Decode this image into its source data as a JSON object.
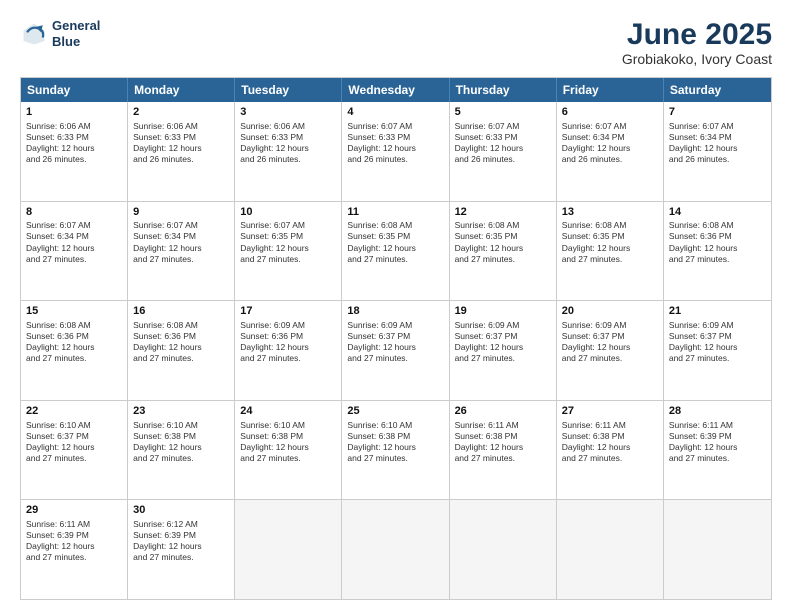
{
  "header": {
    "logo_line1": "General",
    "logo_line2": "Blue",
    "title": "June 2025",
    "subtitle": "Grobiakoko, Ivory Coast"
  },
  "weekdays": [
    "Sunday",
    "Monday",
    "Tuesday",
    "Wednesday",
    "Thursday",
    "Friday",
    "Saturday"
  ],
  "rows": [
    [
      {
        "day": "1",
        "lines": [
          "Sunrise: 6:06 AM",
          "Sunset: 6:33 PM",
          "Daylight: 12 hours",
          "and 26 minutes."
        ]
      },
      {
        "day": "2",
        "lines": [
          "Sunrise: 6:06 AM",
          "Sunset: 6:33 PM",
          "Daylight: 12 hours",
          "and 26 minutes."
        ]
      },
      {
        "day": "3",
        "lines": [
          "Sunrise: 6:06 AM",
          "Sunset: 6:33 PM",
          "Daylight: 12 hours",
          "and 26 minutes."
        ]
      },
      {
        "day": "4",
        "lines": [
          "Sunrise: 6:07 AM",
          "Sunset: 6:33 PM",
          "Daylight: 12 hours",
          "and 26 minutes."
        ]
      },
      {
        "day": "5",
        "lines": [
          "Sunrise: 6:07 AM",
          "Sunset: 6:33 PM",
          "Daylight: 12 hours",
          "and 26 minutes."
        ]
      },
      {
        "day": "6",
        "lines": [
          "Sunrise: 6:07 AM",
          "Sunset: 6:34 PM",
          "Daylight: 12 hours",
          "and 26 minutes."
        ]
      },
      {
        "day": "7",
        "lines": [
          "Sunrise: 6:07 AM",
          "Sunset: 6:34 PM",
          "Daylight: 12 hours",
          "and 26 minutes."
        ]
      }
    ],
    [
      {
        "day": "8",
        "lines": [
          "Sunrise: 6:07 AM",
          "Sunset: 6:34 PM",
          "Daylight: 12 hours",
          "and 27 minutes."
        ]
      },
      {
        "day": "9",
        "lines": [
          "Sunrise: 6:07 AM",
          "Sunset: 6:34 PM",
          "Daylight: 12 hours",
          "and 27 minutes."
        ]
      },
      {
        "day": "10",
        "lines": [
          "Sunrise: 6:07 AM",
          "Sunset: 6:35 PM",
          "Daylight: 12 hours",
          "and 27 minutes."
        ]
      },
      {
        "day": "11",
        "lines": [
          "Sunrise: 6:08 AM",
          "Sunset: 6:35 PM",
          "Daylight: 12 hours",
          "and 27 minutes."
        ]
      },
      {
        "day": "12",
        "lines": [
          "Sunrise: 6:08 AM",
          "Sunset: 6:35 PM",
          "Daylight: 12 hours",
          "and 27 minutes."
        ]
      },
      {
        "day": "13",
        "lines": [
          "Sunrise: 6:08 AM",
          "Sunset: 6:35 PM",
          "Daylight: 12 hours",
          "and 27 minutes."
        ]
      },
      {
        "day": "14",
        "lines": [
          "Sunrise: 6:08 AM",
          "Sunset: 6:36 PM",
          "Daylight: 12 hours",
          "and 27 minutes."
        ]
      }
    ],
    [
      {
        "day": "15",
        "lines": [
          "Sunrise: 6:08 AM",
          "Sunset: 6:36 PM",
          "Daylight: 12 hours",
          "and 27 minutes."
        ]
      },
      {
        "day": "16",
        "lines": [
          "Sunrise: 6:08 AM",
          "Sunset: 6:36 PM",
          "Daylight: 12 hours",
          "and 27 minutes."
        ]
      },
      {
        "day": "17",
        "lines": [
          "Sunrise: 6:09 AM",
          "Sunset: 6:36 PM",
          "Daylight: 12 hours",
          "and 27 minutes."
        ]
      },
      {
        "day": "18",
        "lines": [
          "Sunrise: 6:09 AM",
          "Sunset: 6:37 PM",
          "Daylight: 12 hours",
          "and 27 minutes."
        ]
      },
      {
        "day": "19",
        "lines": [
          "Sunrise: 6:09 AM",
          "Sunset: 6:37 PM",
          "Daylight: 12 hours",
          "and 27 minutes."
        ]
      },
      {
        "day": "20",
        "lines": [
          "Sunrise: 6:09 AM",
          "Sunset: 6:37 PM",
          "Daylight: 12 hours",
          "and 27 minutes."
        ]
      },
      {
        "day": "21",
        "lines": [
          "Sunrise: 6:09 AM",
          "Sunset: 6:37 PM",
          "Daylight: 12 hours",
          "and 27 minutes."
        ]
      }
    ],
    [
      {
        "day": "22",
        "lines": [
          "Sunrise: 6:10 AM",
          "Sunset: 6:37 PM",
          "Daylight: 12 hours",
          "and 27 minutes."
        ]
      },
      {
        "day": "23",
        "lines": [
          "Sunrise: 6:10 AM",
          "Sunset: 6:38 PM",
          "Daylight: 12 hours",
          "and 27 minutes."
        ]
      },
      {
        "day": "24",
        "lines": [
          "Sunrise: 6:10 AM",
          "Sunset: 6:38 PM",
          "Daylight: 12 hours",
          "and 27 minutes."
        ]
      },
      {
        "day": "25",
        "lines": [
          "Sunrise: 6:10 AM",
          "Sunset: 6:38 PM",
          "Daylight: 12 hours",
          "and 27 minutes."
        ]
      },
      {
        "day": "26",
        "lines": [
          "Sunrise: 6:11 AM",
          "Sunset: 6:38 PM",
          "Daylight: 12 hours",
          "and 27 minutes."
        ]
      },
      {
        "day": "27",
        "lines": [
          "Sunrise: 6:11 AM",
          "Sunset: 6:38 PM",
          "Daylight: 12 hours",
          "and 27 minutes."
        ]
      },
      {
        "day": "28",
        "lines": [
          "Sunrise: 6:11 AM",
          "Sunset: 6:39 PM",
          "Daylight: 12 hours",
          "and 27 minutes."
        ]
      }
    ],
    [
      {
        "day": "29",
        "lines": [
          "Sunrise: 6:11 AM",
          "Sunset: 6:39 PM",
          "Daylight: 12 hours",
          "and 27 minutes."
        ]
      },
      {
        "day": "30",
        "lines": [
          "Sunrise: 6:12 AM",
          "Sunset: 6:39 PM",
          "Daylight: 12 hours",
          "and 27 minutes."
        ]
      },
      {
        "day": "",
        "lines": []
      },
      {
        "day": "",
        "lines": []
      },
      {
        "day": "",
        "lines": []
      },
      {
        "day": "",
        "lines": []
      },
      {
        "day": "",
        "lines": []
      }
    ]
  ]
}
